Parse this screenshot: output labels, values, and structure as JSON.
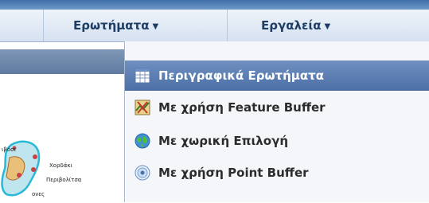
{
  "menubar": {
    "items": [
      {
        "label": "Ερωτήματα",
        "icon": "chevron-down-icon"
      },
      {
        "label": "Εργαλεία",
        "icon": "chevron-down-icon"
      }
    ]
  },
  "dropdown": {
    "items": [
      {
        "label": "Περιγραφικά Ερωτήματα",
        "icon": "table-icon",
        "selected": true
      },
      {
        "label": "Με χρήση Feature Buffer",
        "icon": "map-buffer-icon",
        "selected": false
      },
      {
        "label": "Με χωρική Επιλογή",
        "icon": "globe-icon",
        "selected": false
      },
      {
        "label": "Με χρήση Point Buffer",
        "icon": "point-buffer-icon",
        "selected": false
      }
    ]
  },
  "map": {
    "labels": [
      "ιβόσι",
      "Χορδάκι",
      "Περιβολίτσα",
      "ονες"
    ]
  },
  "colors": {
    "accent": "#4c70a6",
    "menu_text": "#1f3e66"
  }
}
